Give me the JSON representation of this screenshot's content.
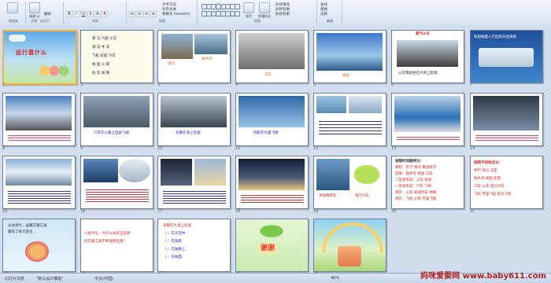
{
  "ribbon": {
    "clipboard_label": "剪贴板",
    "new_slide_label": "新建\n幻灯片",
    "delete_label": "删除",
    "slides_label": "幻灯片",
    "font_label": "字体",
    "paragraph_label": "段落",
    "text_direction_label": "文字方向",
    "align_text_label": "对齐文本",
    "smartart_label": "转换为 SmartArt",
    "drawing_label": "绘图",
    "arrange_label": "排列",
    "quick_styles_label": "快速样式",
    "shape_fill_label": "形状填充",
    "shape_outline_label": "形状轮廓",
    "shape_effects_label": "形状效果",
    "find_label": "查找",
    "replace_label": "替换",
    "select_label": "选择",
    "editing_label": "编辑"
  },
  "slides": [
    {
      "num": "1",
      "title": "运行靠什么"
    },
    {
      "num": "2",
      "lines": [
        "轿 马 汽船 火车",
        "骑 马 牛 车",
        "飞机 轮船 汽车",
        "帆 船 火 箭",
        "拉 车 地 铁"
      ]
    },
    {
      "num": "3",
      "captions": [
        "骑马",
        "独木舟"
      ]
    },
    {
      "num": "4",
      "captions": [
        "马车"
      ]
    },
    {
      "num": "5",
      "captions": [
        "帆船"
      ]
    },
    {
      "num": "6",
      "title": "蒸汽火车",
      "caption": "火车我想坐在大地上奔驰"
    },
    {
      "num": "7",
      "title": "轮船载着人们远到天边海角"
    },
    {
      "num": "8"
    },
    {
      "num": "9",
      "caption": "汽车在公路上自由飞驰"
    },
    {
      "num": "10",
      "caption": "军舰在海上巡逻"
    },
    {
      "num": "11",
      "caption": "快艇在水面飞驰"
    },
    {
      "num": "12"
    },
    {
      "num": "13"
    },
    {
      "num": "14"
    },
    {
      "num": "15"
    },
    {
      "num": "16"
    },
    {
      "num": "17"
    },
    {
      "num": "18"
    },
    {
      "num": "19",
      "captions": [
        "水陆两用车",
        "电力汽车"
      ]
    },
    {
      "num": "20",
      "lines": [
        "按照时间顺序分：",
        "最初：步行 骑马 乘坐轿子",
        "后来：独木舟 帆船 马车",
        "二百多年前：火车 轮船",
        "一百多年前：汽车 飞机",
        "现在：火车 高速列车 地铁",
        "现在：飞机 火箭 宇宙飞船"
      ]
    },
    {
      "num": "21",
      "lines": [
        "按照不同地点分：",
        "步行 骑马 马车",
        "独木舟 帆船 轮船",
        "汽车 火车 电力汽车",
        "飞机 宇宙飞船 航天飞机"
      ]
    },
    {
      "num": "22",
      "lines": [
        "从古到今，运输交通工具",
        "都有了很大变化"
      ]
    },
    {
      "num": "23",
      "lines": [
        "小组讨论，为什么会有这些新",
        "的交通工具不断发明出来？"
      ]
    },
    {
      "num": "24",
      "lines": [
        "军舰在大海上巡逻",
        "（ ）在天空中",
        "（ ）在海底",
        "（ ）在陆路上",
        "（ ）在地面"
      ]
    },
    {
      "num": "25",
      "title": "谢谢"
    },
    {
      "num": "26"
    }
  ],
  "status": {
    "slide_info": "幻灯片浏览",
    "theme": "\"默认设计模板\"",
    "language": "中文(中国)",
    "zoom": "46%"
  },
  "watermark": "妈咪爱婴网 www.baby611.com"
}
